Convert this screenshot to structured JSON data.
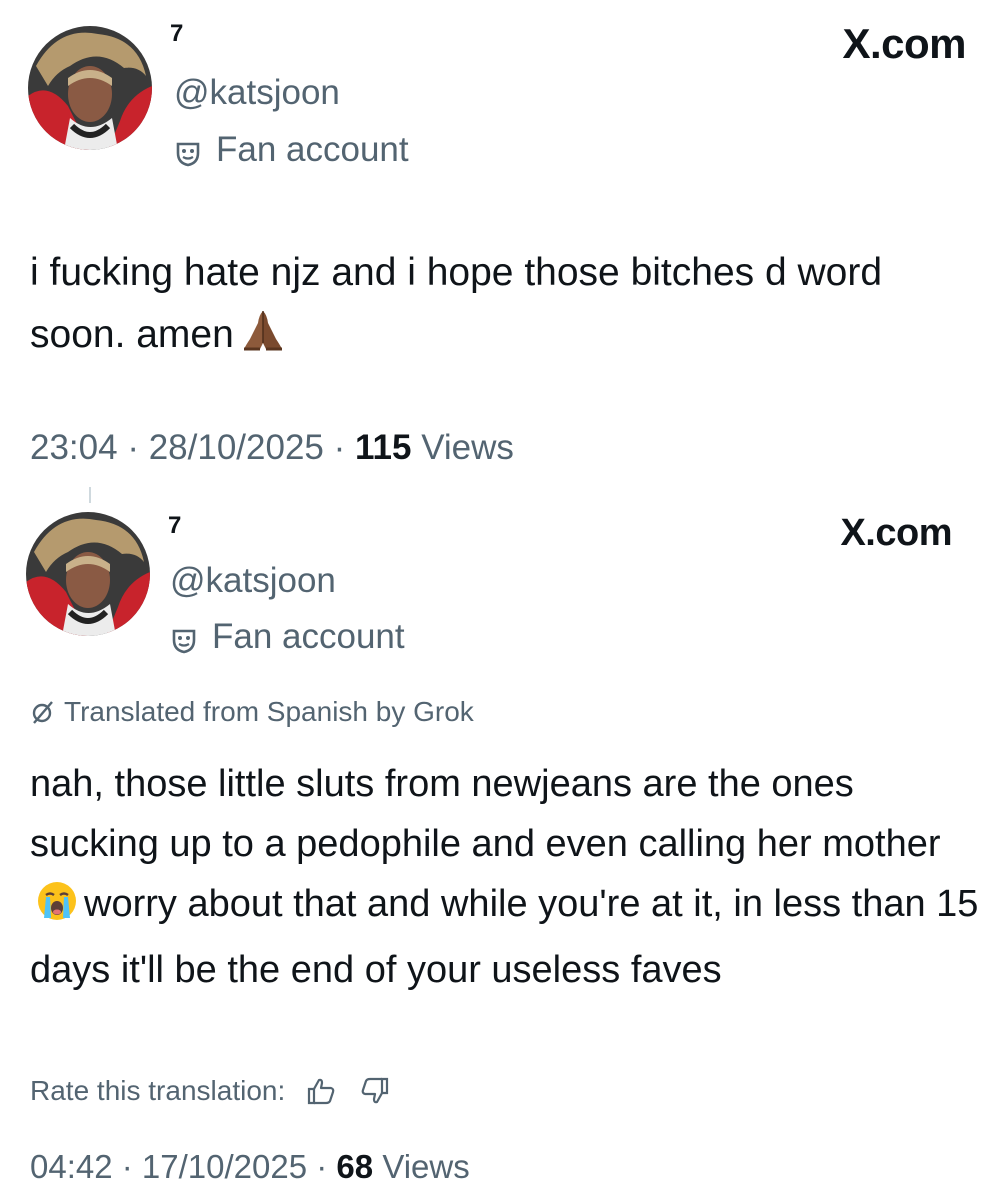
{
  "posts": [
    {
      "display_name": "7",
      "handle": "@katsjoon",
      "account_label": "Fan account",
      "brand": "X.com",
      "text": "i fucking hate njz and i hope those bitches d word soon. amen",
      "text_emoji": "folded-hands-emoji",
      "time": "23:04",
      "date": "28/10/2025",
      "views_count": "115",
      "views_label": "Views"
    },
    {
      "display_name": "7",
      "handle": "@katsjoon",
      "account_label": "Fan account",
      "brand": "X.com",
      "translation_note": "Translated from Spanish by Grok",
      "text_before_emoji": "nah, those little sluts from newjeans are the ones sucking up to a pedophile and even calling her mother",
      "text_emoji": "loudly-crying-face-emoji",
      "text_after_emoji": "worry about that and while you're at it, in less than 15 days it'll be the end of your useless faves",
      "rate_label": "Rate this translation:",
      "time": "04:42",
      "date": "17/10/2025",
      "views_count": "68",
      "views_label": "Views"
    }
  ],
  "meta_separator": " · ",
  "colors": {
    "text_primary": "#0f1419",
    "text_secondary": "#536471",
    "avatar_red": "#c8232c",
    "avatar_fur": "#b59a6e"
  },
  "icons": {
    "account_label": "persona-mask-icon",
    "translation": "grok-icon",
    "rate_up": "thumbs-up-icon",
    "rate_down": "thumbs-down-icon"
  }
}
